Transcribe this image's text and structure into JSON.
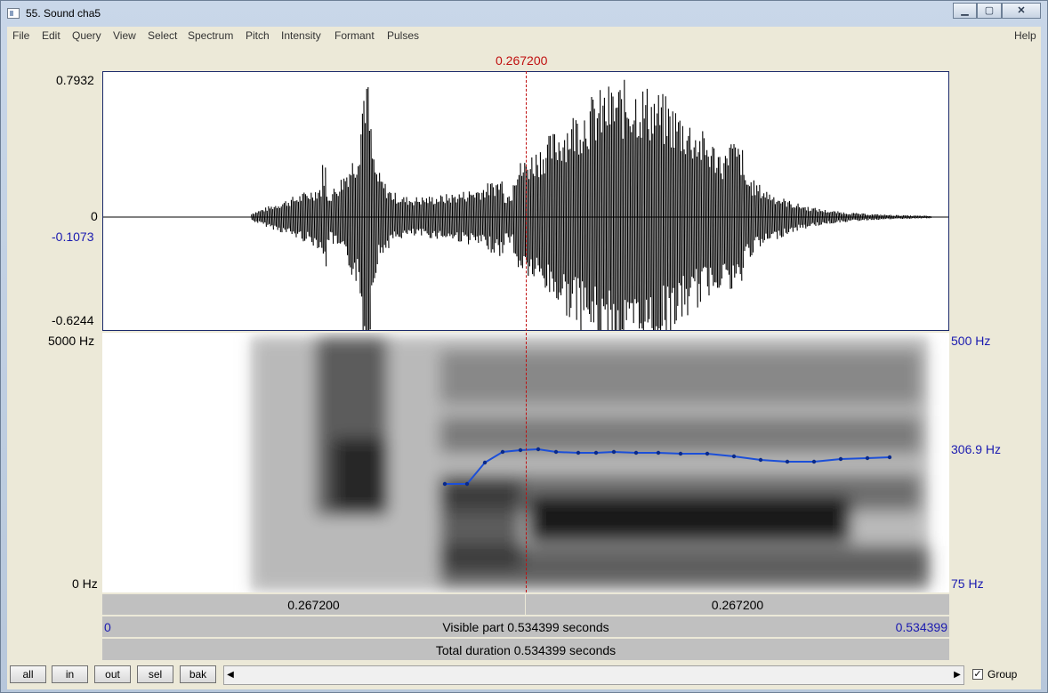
{
  "window": {
    "title": "55. Sound cha5"
  },
  "menu": {
    "items": [
      "File",
      "Edit",
      "Query",
      "View",
      "Select",
      "Spectrum",
      "Pitch",
      "Intensity",
      "Formant",
      "Pulses"
    ],
    "help": "Help"
  },
  "cursor": {
    "time_label": "0.267200"
  },
  "waveform": {
    "max_label": "0.7932",
    "zero_label": "0",
    "cursor_value_label": "-0.1073",
    "min_label": "-0.6244"
  },
  "spectrogram": {
    "top_label": "5000 Hz",
    "bottom_label": "0 Hz"
  },
  "pitch": {
    "top_label": "500 Hz",
    "value_label": "306.9 Hz",
    "bottom_label": "75 Hz",
    "color": "#1c4fd8"
  },
  "time_bars": {
    "left_segment": "0.267200",
    "right_segment": "0.267200",
    "visible_start": "0",
    "visible_text": "Visible part 0.534399 seconds",
    "visible_end": "0.534399",
    "total_text": "Total duration 0.534399 seconds"
  },
  "buttons": {
    "all": "all",
    "in": "in",
    "out": "out",
    "sel": "sel",
    "bak": "bak"
  },
  "group": {
    "label": "Group",
    "checked": true
  }
}
